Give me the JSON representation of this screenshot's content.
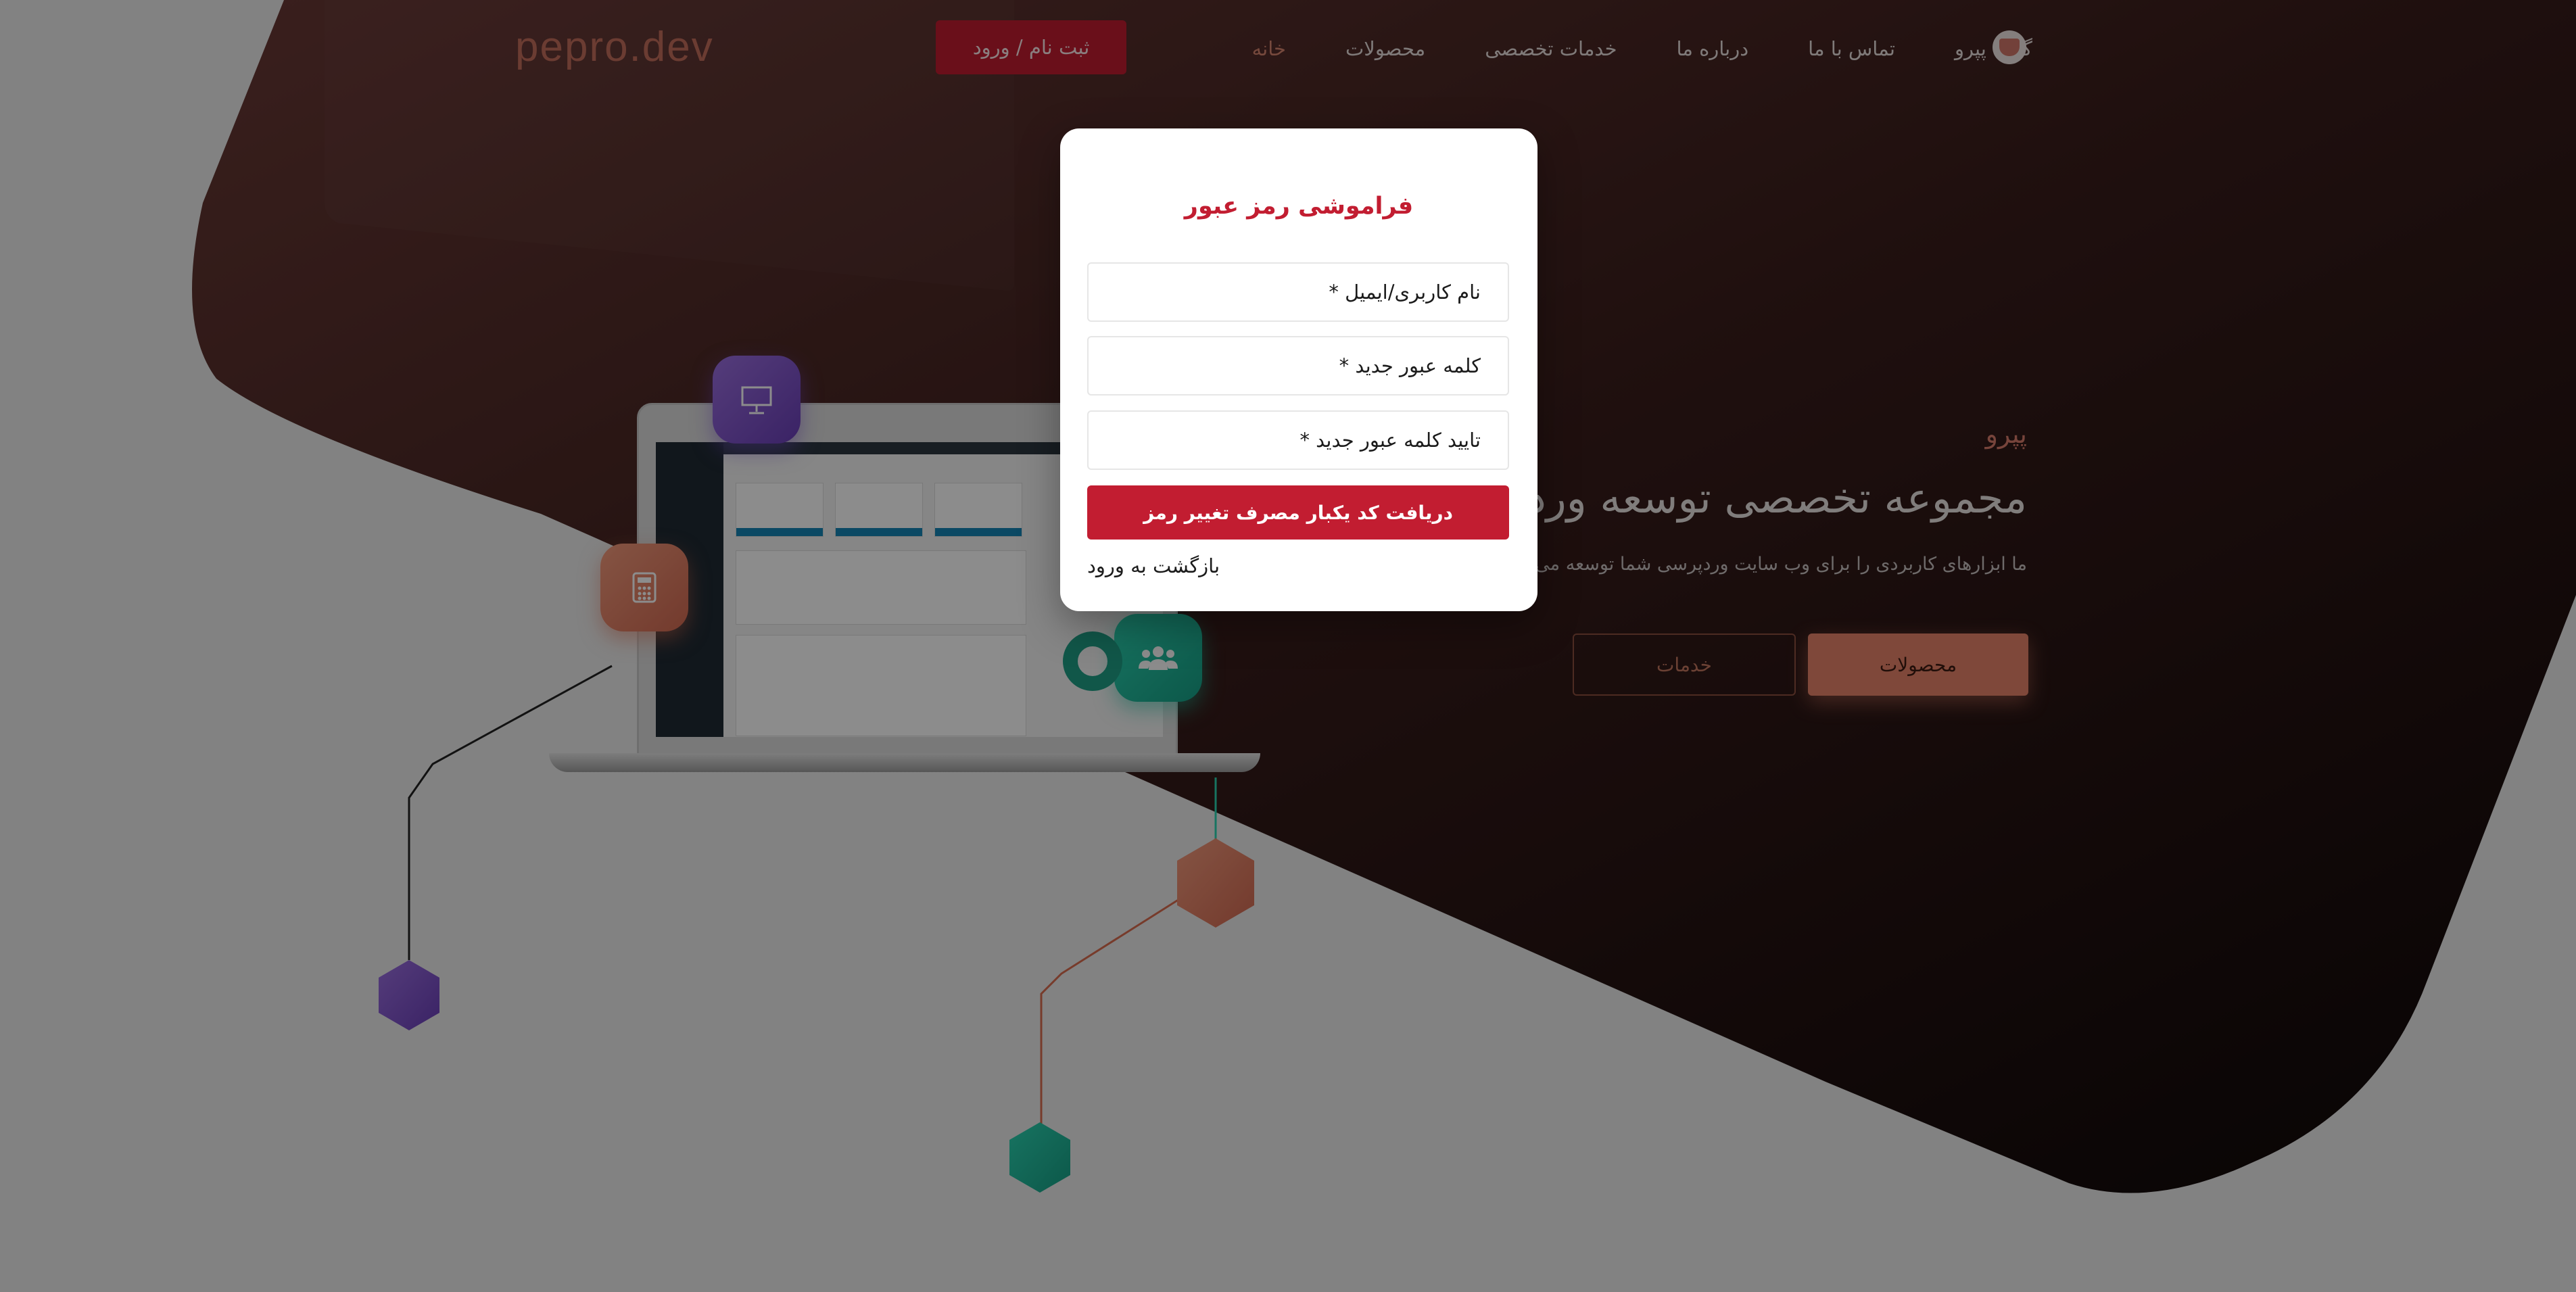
{
  "header": {
    "logo_text": "pepro.dev",
    "nav": [
      {
        "label": "خانه",
        "active": true
      },
      {
        "label": "محصولات",
        "active": false
      },
      {
        "label": "خدمات تخصصی",
        "active": false
      },
      {
        "label": "درباره ما",
        "active": false
      },
      {
        "label": "تماس با ما",
        "active": false
      },
      {
        "label": "گروه پپرو",
        "active": false
      }
    ],
    "login_label": "ثبت نام / ورود"
  },
  "hero": {
    "kicker": "پپرو",
    "title": "مجموعه تخصصی توسعه ورد",
    "description": "ما ابزارهای کاربردی را برای وب سایت وردپرسی شما توسعه می ده",
    "primary_button": "محصولات",
    "secondary_button": "خدمات"
  },
  "modal": {
    "title": "فراموشی رمز عبور",
    "fields": {
      "username_placeholder": "نام کاربری/ایمیل *",
      "new_password_placeholder": "کلمه عبور جدید *",
      "confirm_password_placeholder": "تایید کلمه عبور جدید *"
    },
    "submit_label": "دریافت کد یکبار مصرف تغییر رمز",
    "back_label": "بازگشت به ورود"
  },
  "colors": {
    "accent": "#c21d31",
    "brand": "#d8856f",
    "dark_bg": "#3a1f1d"
  },
  "icons": [
    "presentation-icon",
    "calculator-icon",
    "users-icon",
    "cup-logo-icon"
  ]
}
